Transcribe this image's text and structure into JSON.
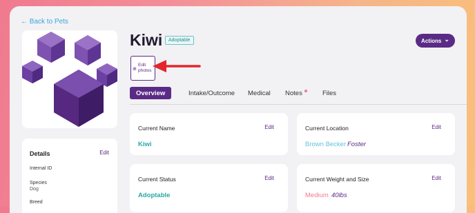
{
  "back_link": "← Back to Pets",
  "pet": {
    "name": "Kiwi",
    "badge": "Adoptable"
  },
  "actions_button": {
    "label": "Actions",
    "chevron": "⌄"
  },
  "edit_photos": {
    "line1": "Edit",
    "line2": "photos"
  },
  "tabs": [
    {
      "label": "Overview"
    },
    {
      "label": "Intake/Outcome"
    },
    {
      "label": "Medical"
    },
    {
      "label": "Notes"
    },
    {
      "label": "Files"
    }
  ],
  "details": {
    "title": "Details",
    "edit": "Edit",
    "internal_id_label": "Internal ID",
    "species_label": "Species",
    "species_value": "Dog",
    "breed_label": "Breed"
  },
  "cards": {
    "current_name": {
      "title": "Current Name",
      "edit": "Edit",
      "value": "Kiwi"
    },
    "current_location": {
      "title": "Current Location",
      "edit": "Edit",
      "value": "Brown Becker",
      "value2": "Foster"
    },
    "current_status": {
      "title": "Current Status",
      "edit": "Edit",
      "value": "Adoptable"
    },
    "current_weight": {
      "title": "Current Weight and Size",
      "edit": "Edit",
      "value": "Medium",
      "value2": "40lbs"
    }
  },
  "colors": {
    "accent": "#5a2b86",
    "teal": "#2aa9a4",
    "link": "#3aa7d8",
    "pink": "#f07a8e"
  }
}
